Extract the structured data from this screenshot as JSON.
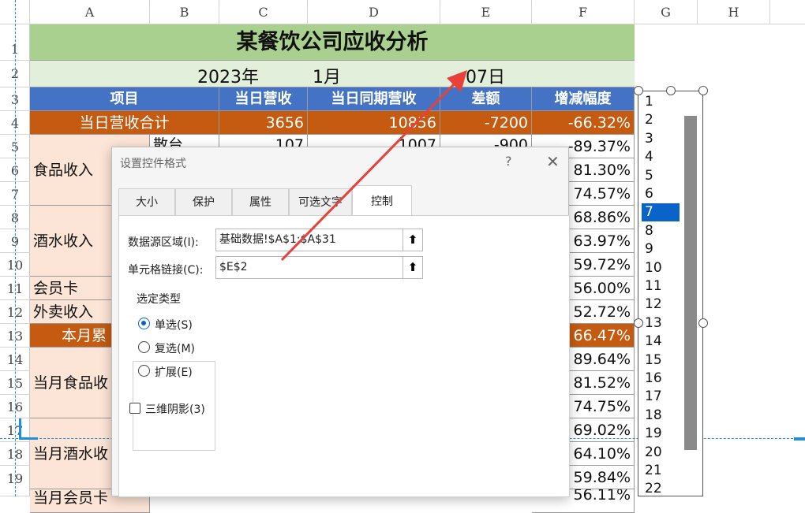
{
  "columns": [
    "A",
    "B",
    "C",
    "D",
    "E",
    "F",
    "G",
    "H"
  ],
  "rows": [
    "1",
    "2",
    "3",
    "4",
    "5",
    "6",
    "7",
    "8",
    "9",
    "10",
    "11",
    "12",
    "13",
    "14",
    "15",
    "16",
    "17",
    "18",
    "19"
  ],
  "sheet": {
    "title": "某餐饮公司应收分析",
    "date_year": "2023年",
    "date_month": "1月",
    "date_day": "07日",
    "headers": [
      "项目",
      "当日营收",
      "当日同期营收",
      "差额",
      "增减幅度"
    ],
    "total_row": {
      "label": "当日营收合计",
      "c": "3656",
      "d": "10856",
      "e": "-7200",
      "f": "-66.32%"
    },
    "row5": {
      "b": "散台",
      "c": "107",
      "d": "1007",
      "e": "-900",
      "f": "-89.37%"
    },
    "food_label": "食品收入",
    "wine_label": "酒水收入",
    "member_label": "会员卡",
    "takeout_label": "外卖收入",
    "month_total_label": "本月累",
    "month_food_label": "当月食品收",
    "month_wine_label": "当月酒水收",
    "row20_label": "当月会员卡",
    "f_values": [
      "81.30%",
      "74.57%",
      "68.86%",
      "63.97%",
      "59.72%",
      "56.00%",
      "52.72%",
      "66.47%",
      "89.64%",
      "81.52%",
      "74.75%",
      "69.02%",
      "64.10%",
      "59.84%",
      "56.11%"
    ]
  },
  "listbox": {
    "items": [
      "1",
      "2",
      "3",
      "4",
      "5",
      "6",
      "7",
      "8",
      "9",
      "10",
      "11",
      "12",
      "13",
      "14",
      "15",
      "16",
      "17",
      "18",
      "19",
      "20",
      "21",
      "22"
    ],
    "selected": "7"
  },
  "dialog": {
    "title": "设置控件格式",
    "help": "?",
    "close": "✕",
    "tabs": [
      "大小",
      "保护",
      "属性",
      "可选文字",
      "控制"
    ],
    "active_tab": "控制",
    "source_label": "数据源区域(I):",
    "source_value": "基础数据!$A$1:$A$31",
    "link_label": "单元格链接(C):",
    "link_value": "$E$2",
    "group_title": "选定类型",
    "radio_single": "单选(S)",
    "radio_multi": "复选(M)",
    "radio_extend": "扩展(E)",
    "shadow_label": "三维阴影(3)",
    "selected_type": "单选(S)",
    "shadow_checked": false
  },
  "colors": {
    "title_bg": "#a9d08e",
    "date_bg": "#e2efda",
    "header_bg": "#4472c4",
    "total_bg": "#c55a11",
    "label_bg": "#fce4d6",
    "selection": "#0a63c9",
    "arrow": "#e8403a"
  }
}
